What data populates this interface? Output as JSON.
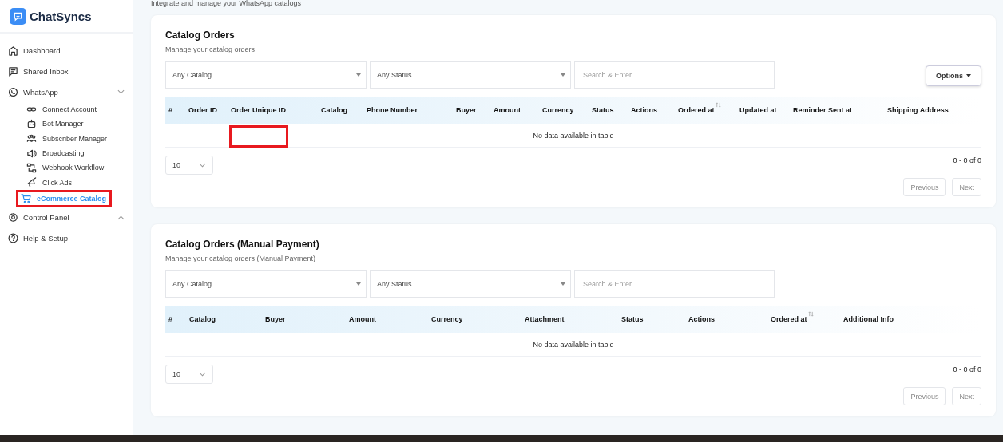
{
  "brand": {
    "name": "ChatSyncs"
  },
  "sidebar": {
    "items": [
      {
        "label": "Dashboard",
        "selected": false,
        "highlighted": false
      },
      {
        "label": "Shared Inbox",
        "selected": false,
        "highlighted": false
      },
      {
        "label": "WhatsApp",
        "selected": false,
        "highlighted": false,
        "expanded": true,
        "children": [
          {
            "label": "Connect Account",
            "selected": false,
            "highlighted": false
          },
          {
            "label": "Bot Manager",
            "selected": false,
            "highlighted": false
          },
          {
            "label": "Subscriber Manager",
            "selected": false,
            "highlighted": false
          },
          {
            "label": "Broadcasting",
            "selected": false,
            "highlighted": false
          },
          {
            "label": "Webhook Workflow",
            "selected": false,
            "highlighted": false
          },
          {
            "label": "Click Ads",
            "selected": false,
            "highlighted": false
          },
          {
            "label": "eCommerce Catalog",
            "selected": true,
            "highlighted": true
          }
        ]
      },
      {
        "label": "Control Panel",
        "selected": false,
        "highlighted": false,
        "expanded": false
      },
      {
        "label": "Help & Setup",
        "selected": false,
        "highlighted": false
      }
    ]
  },
  "page": {
    "subtitle": "Integrate and manage your WhatsApp catalogs"
  },
  "cards": [
    {
      "title": "Catalog Orders",
      "subtitle": "Manage your catalog orders",
      "catalog_filter": "Any Catalog",
      "status_filter": "Any Status",
      "search": {
        "placeholder": "Search & Enter..."
      },
      "options_button": "Options",
      "columns": [
        {
          "label": "#",
          "sortable": false,
          "highlighted": false
        },
        {
          "label": "Order ID",
          "sortable": false,
          "highlighted": false
        },
        {
          "label": "Order Unique ID",
          "sortable": false,
          "highlighted": true
        },
        {
          "label": "Catalog",
          "sortable": false,
          "highlighted": false
        },
        {
          "label": "Phone Number",
          "sortable": false,
          "highlighted": false
        },
        {
          "label": "Buyer",
          "sortable": false,
          "highlighted": false
        },
        {
          "label": "Amount",
          "sortable": false,
          "highlighted": false
        },
        {
          "label": "Currency",
          "sortable": false,
          "highlighted": false
        },
        {
          "label": "Status",
          "sortable": false,
          "highlighted": false
        },
        {
          "label": "Actions",
          "sortable": false,
          "highlighted": false
        },
        {
          "label": "Ordered at",
          "sortable": true,
          "highlighted": false
        },
        {
          "label": "Updated at",
          "sortable": false,
          "highlighted": false
        },
        {
          "label": "Reminder Sent at",
          "sortable": false,
          "highlighted": false
        },
        {
          "label": "Shipping Address",
          "sortable": false,
          "highlighted": false
        }
      ],
      "empty_text": "No data available in table",
      "page_size": "10",
      "range": "0 - 0 of 0",
      "previous": "Previous",
      "next": "Next"
    },
    {
      "title": "Catalog Orders (Manual Payment)",
      "subtitle": "Manage your catalog orders (Manual Payment)",
      "catalog_filter": "Any Catalog",
      "status_filter": "Any Status",
      "search": {
        "placeholder": "Search & Enter..."
      },
      "columns": [
        {
          "label": "#",
          "sortable": false,
          "highlighted": false
        },
        {
          "label": "Catalog",
          "sortable": false,
          "highlighted": false
        },
        {
          "label": "Buyer",
          "sortable": false,
          "highlighted": false
        },
        {
          "label": "Amount",
          "sortable": false,
          "highlighted": false
        },
        {
          "label": "Currency",
          "sortable": false,
          "highlighted": false
        },
        {
          "label": "Attachment",
          "sortable": false,
          "highlighted": false
        },
        {
          "label": "Status",
          "sortable": false,
          "highlighted": false
        },
        {
          "label": "Actions",
          "sortable": false,
          "highlighted": false
        },
        {
          "label": "Ordered at",
          "sortable": true,
          "highlighted": false
        },
        {
          "label": "Additional Info",
          "sortable": false,
          "highlighted": false
        }
      ],
      "empty_text": "No data available in table",
      "page_size": "10",
      "range": "0 - 0 of 0",
      "previous": "Previous",
      "next": "Next"
    }
  ]
}
